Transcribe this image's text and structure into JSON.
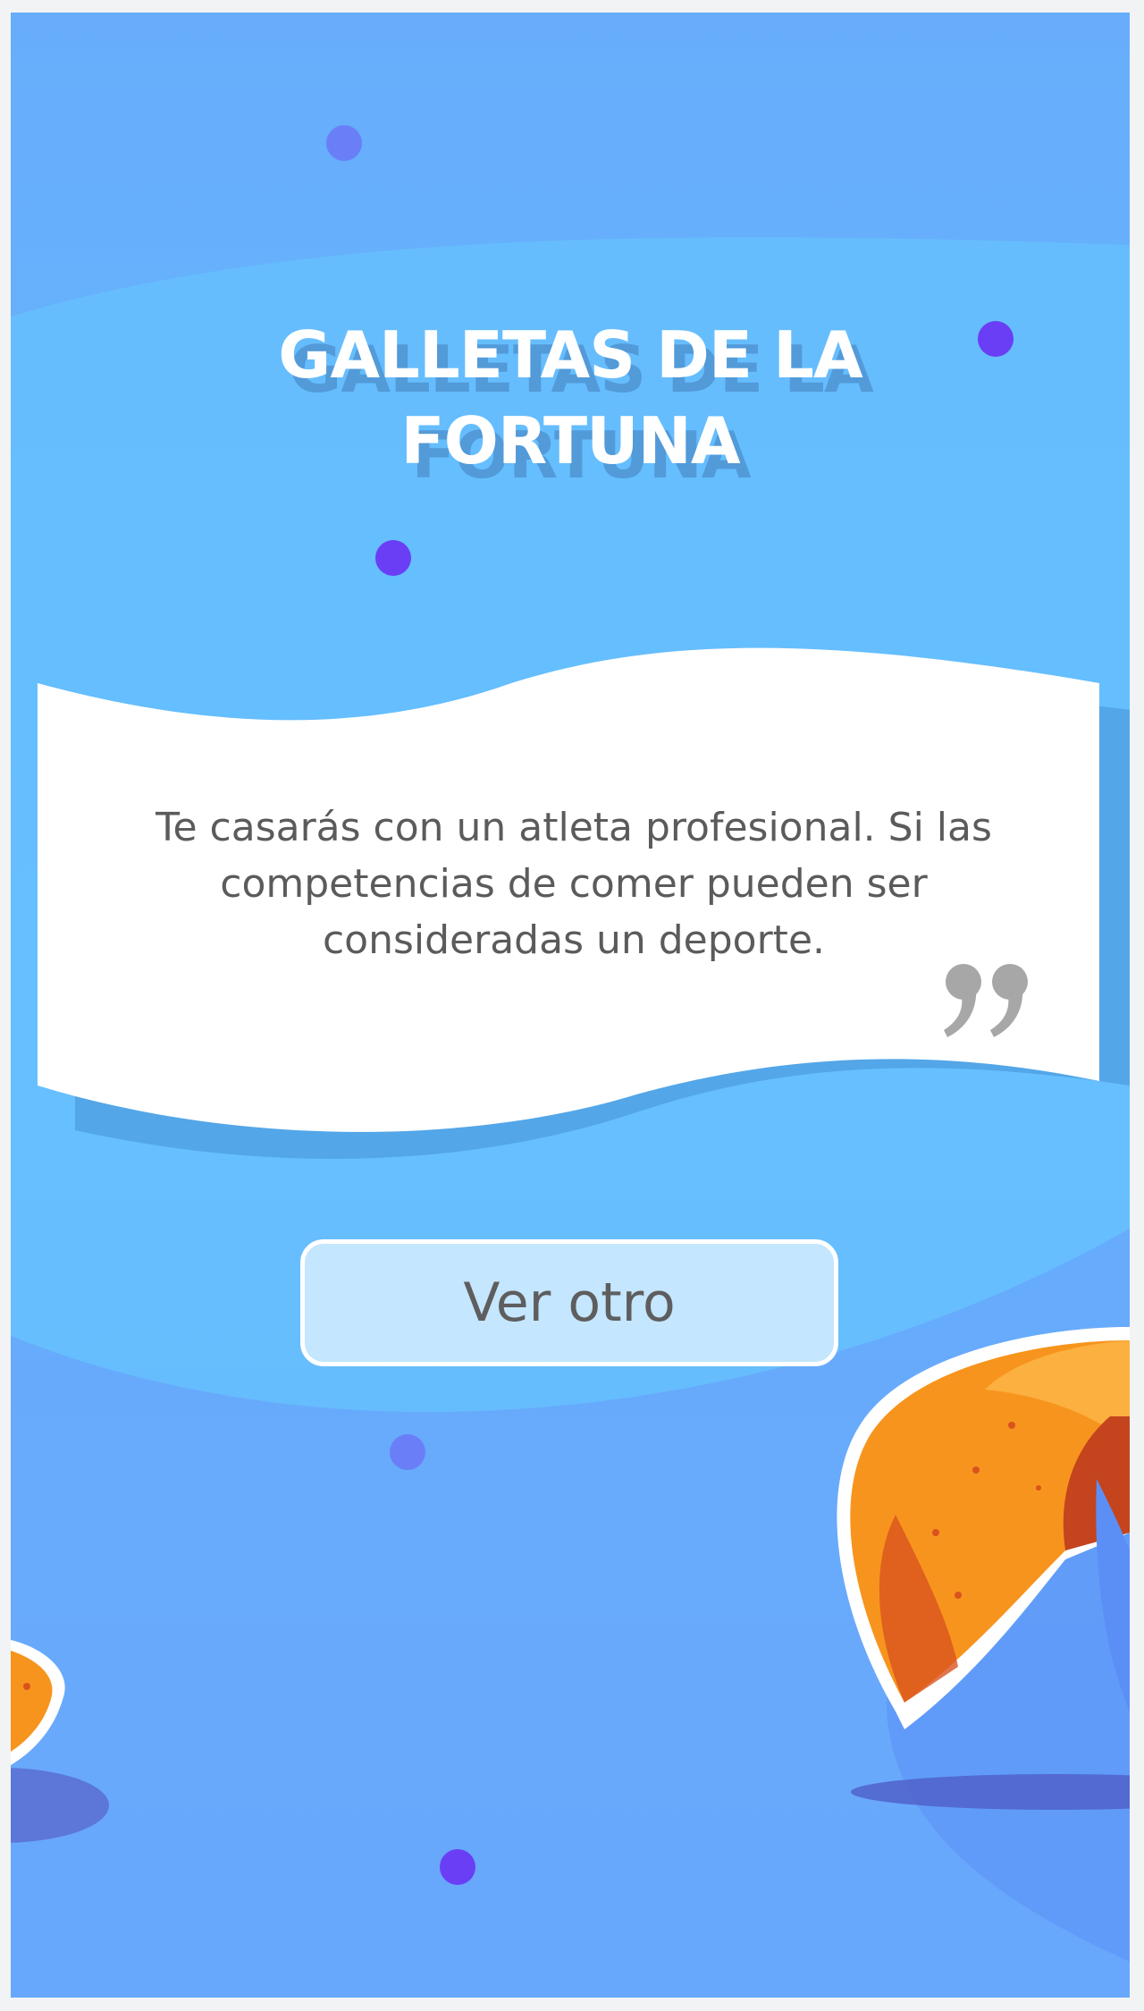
{
  "app": {
    "title": "GALLETAS DE LA FORTUNA"
  },
  "fortune": {
    "message": "Te casarás con un atleta profesional. Si las competencias de comer pueden ser consideradas un deporte.",
    "quote_icon": "closing-quote-icon"
  },
  "actions": {
    "next_label": "Ver otro"
  },
  "colors": {
    "background": "#67b3fd",
    "card": "#ffffff",
    "button_fill": "#c4e6ff",
    "dot_dark": "#6a3ef5",
    "dot_light": "#6a7ff7",
    "cookie_orange": "#f7941d"
  },
  "decorations": {
    "cookie_icon": "fortune-cookie-icon"
  }
}
